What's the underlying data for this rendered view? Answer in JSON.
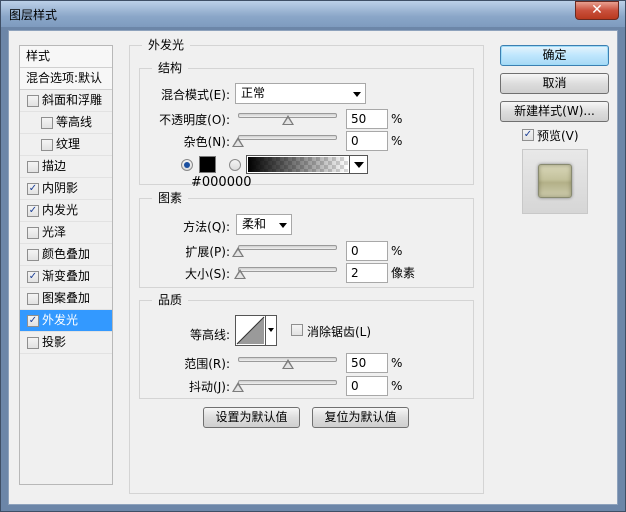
{
  "window": {
    "title": "图层样式",
    "close_glyph": "✕"
  },
  "style_list": {
    "header": "样式",
    "blend_options": "混合选项:默认",
    "items": [
      {
        "label": "斜面和浮雕",
        "checked": false,
        "sub": false,
        "selected": false
      },
      {
        "label": "等高线",
        "checked": false,
        "sub": true,
        "selected": false
      },
      {
        "label": "纹理",
        "checked": false,
        "sub": true,
        "selected": false
      },
      {
        "label": "描边",
        "checked": false,
        "sub": false,
        "selected": false
      },
      {
        "label": "内阴影",
        "checked": true,
        "sub": false,
        "selected": false
      },
      {
        "label": "内发光",
        "checked": true,
        "sub": false,
        "selected": false
      },
      {
        "label": "光泽",
        "checked": false,
        "sub": false,
        "selected": false
      },
      {
        "label": "颜色叠加",
        "checked": false,
        "sub": false,
        "selected": false
      },
      {
        "label": "渐变叠加",
        "checked": true,
        "sub": false,
        "selected": false
      },
      {
        "label": "图案叠加",
        "checked": false,
        "sub": false,
        "selected": false
      },
      {
        "label": "外发光",
        "checked": true,
        "sub": false,
        "selected": true
      },
      {
        "label": "投影",
        "checked": false,
        "sub": false,
        "selected": false
      }
    ]
  },
  "outer_glow": {
    "title": "外发光",
    "structure": {
      "title": "结构",
      "blend_mode_label": "混合模式(E):",
      "blend_mode_value": "正常",
      "opacity_label": "不透明度(O):",
      "opacity_value": "50",
      "opacity_level": 50,
      "noise_label": "杂色(N):",
      "noise_value": "0",
      "noise_level": 0,
      "percent": "%",
      "color_hex": "#000000",
      "color_swatch": "#000000",
      "color_radio_selected": true
    },
    "elements": {
      "title": "图素",
      "technique_label": "方法(Q):",
      "technique_value": "柔和",
      "spread_label": "扩展(P):",
      "spread_value": "0",
      "spread_level": 0,
      "size_label": "大小(S):",
      "size_value": "2",
      "size_level": 2,
      "percent": "%",
      "size_unit": "像素"
    },
    "quality": {
      "title": "品质",
      "contour_label": "等高线:",
      "anti_alias_label": "消除锯齿(L)",
      "anti_alias_checked": false,
      "range_label": "范围(R):",
      "range_value": "50",
      "range_level": 50,
      "jitter_label": "抖动(J):",
      "jitter_value": "0",
      "jitter_level": 0,
      "percent": "%"
    },
    "make_default_label": "设置为默认值",
    "reset_default_label": "复位为默认值"
  },
  "actions": {
    "ok_label": "确定",
    "cancel_label": "取消",
    "new_style_label": "新建样式(W)...",
    "preview_label": "预览(V)",
    "preview_checked": true
  }
}
